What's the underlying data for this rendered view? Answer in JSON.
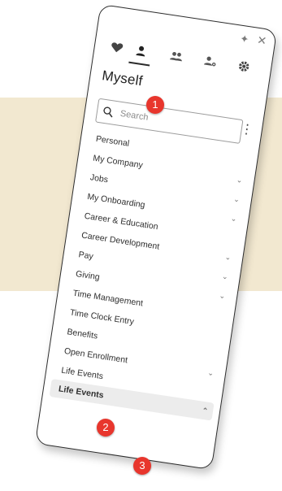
{
  "panel": {
    "title": "Myself",
    "search": {
      "placeholder": "Search"
    },
    "menu": [
      {
        "label": "Personal",
        "expandable": false
      },
      {
        "label": "My Company",
        "expandable": true
      },
      {
        "label": "Jobs",
        "expandable": true
      },
      {
        "label": "My Onboarding",
        "expandable": true
      },
      {
        "label": "Career & Education",
        "expandable": false
      },
      {
        "label": "Career Development",
        "expandable": true
      },
      {
        "label": "Pay",
        "expandable": true
      },
      {
        "label": "Giving",
        "expandable": true
      },
      {
        "label": "Time Management",
        "expandable": false
      },
      {
        "label": "Time Clock Entry",
        "expandable": false
      },
      {
        "label": "Benefits",
        "expandable": false
      },
      {
        "label": "Open Enrollment",
        "expandable": true
      },
      {
        "label": "Life Events",
        "expandable": false
      }
    ],
    "selected_item": {
      "label": "Life Events",
      "expanded": true
    }
  },
  "markers": [
    "1",
    "2",
    "3"
  ],
  "icons": [
    "heart-icon",
    "person-icon",
    "people-icon",
    "person-key-icon",
    "gear-icon",
    "pin-icon",
    "close-icon",
    "search-icon",
    "kebab-icon",
    "chevron-down-icon",
    "chevron-up-icon"
  ],
  "colors": {
    "backdrop": "#f2e8d0",
    "marker": "#e8362d",
    "selected_bg": "#ececec"
  }
}
